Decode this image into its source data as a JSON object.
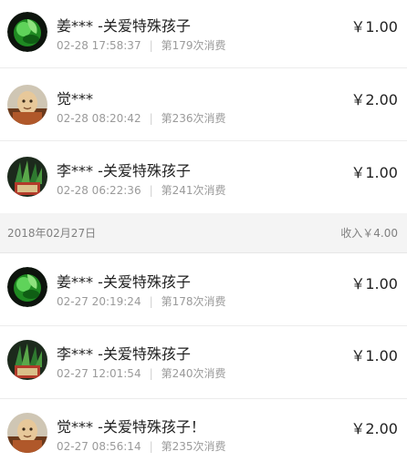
{
  "transactions_top": [
    {
      "name": "姜*** -关爱特殊孩子",
      "time": "02-28 17:58:37",
      "count": "第179次消费",
      "amount": "￥1.00",
      "avatar": "green-leaf-icon"
    },
    {
      "name": "觉***",
      "time": "02-28 08:20:42",
      "count": "第236次消费",
      "amount": "￥2.00",
      "avatar": "monk-figure-icon"
    },
    {
      "name": "李*** -关爱特殊孩子",
      "time": "02-28 06:22:36",
      "count": "第241次消费",
      "amount": "￥1.00",
      "avatar": "plant-pot-icon"
    }
  ],
  "date_group": {
    "date": "2018年02月27日",
    "income": "收入￥4.00"
  },
  "transactions_bottom": [
    {
      "name": "姜*** -关爱特殊孩子",
      "time": "02-27 20:19:24",
      "count": "第178次消费",
      "amount": "￥1.00",
      "avatar": "green-leaf-icon"
    },
    {
      "name": "李*** -关爱特殊孩子",
      "time": "02-27 12:01:54",
      "count": "第240次消费",
      "amount": "￥1.00",
      "avatar": "plant-pot-icon"
    },
    {
      "name": "觉*** -关爱特殊孩子！",
      "time": "02-27 08:56:14",
      "count": "第235次消费",
      "amount": "￥2.00",
      "avatar": "monk-figure-icon"
    }
  ],
  "separator": "|",
  "colors": {
    "name": "#222222",
    "meta": "#9a9a9a",
    "header_bg": "#f4f4f4"
  }
}
